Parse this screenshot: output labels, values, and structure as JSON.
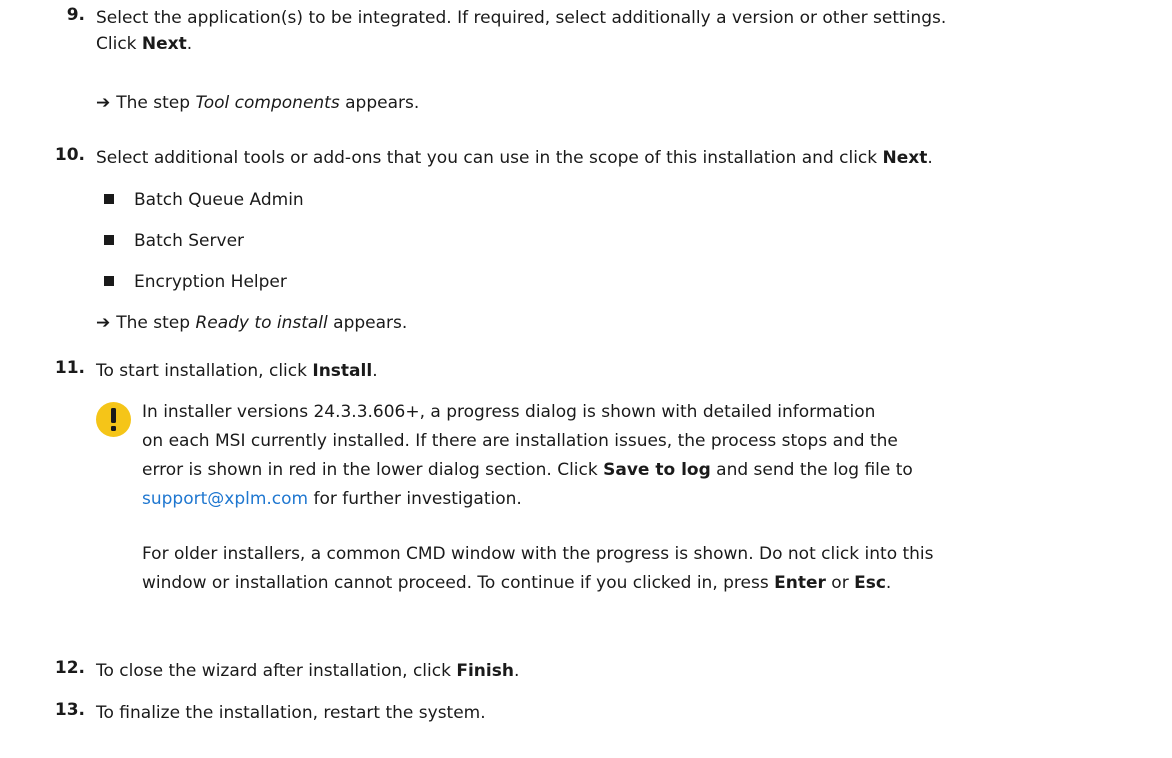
{
  "steps": {
    "s9": {
      "number": "9.",
      "line1": "Select the application(s) to be integrated. If required, select additionally a version or other settings.",
      "line2_pre": "Click ",
      "line2_bold": "Next",
      "line2_post": ".",
      "result_pre": "The step ",
      "result_italic": "Tool components",
      "result_post": " appears."
    },
    "s10": {
      "number": "10.",
      "text_pre": "Select additional tools or add-ons that you can use in the scope of this installation and click ",
      "text_bold": "Next",
      "text_post": ".",
      "bullets": [
        "Batch Queue Admin",
        "Batch Server",
        "Encryption Helper"
      ],
      "result_pre": "The step ",
      "result_italic": "Ready to install",
      "result_post": " appears."
    },
    "s11": {
      "number": "11.",
      "text_pre": "To start installation, click ",
      "text_bold": "Install",
      "text_post": ".",
      "notice": {
        "line1": "In installer versions 24.3.3.606+, a progress dialog is shown with detailed information",
        "line2": "on each MSI currently installed. If there are installation issues, the process stops and the",
        "line3_pre": "error is shown in red in the lower dialog section. Click ",
        "line3_bold": "Save to log",
        "line3_post": " and send the log file to",
        "line4_link": "support@xplm.com",
        "line4_post": " for further investigation.",
        "para2_line1": "For older installers, a common CMD window with the progress is shown. Do not click into this",
        "para2_line2_pre": "window or installation cannot proceed. To continue if you clicked in, press ",
        "para2_line2_bold1": "Enter",
        "para2_line2_mid": " or ",
        "para2_line2_bold2": "Esc",
        "para2_line2_post": "."
      }
    },
    "s12": {
      "number": "12.",
      "text_pre": "To close the wizard after installation, click ",
      "text_bold": "Finish",
      "text_post": "."
    },
    "s13": {
      "number": "13.",
      "text": "To finalize the installation, restart the system."
    }
  },
  "result_arrow": "➔",
  "icons": {
    "notice": "exclamation-icon",
    "notice_color": "#f5c518",
    "link_color": "#1f77d0"
  }
}
